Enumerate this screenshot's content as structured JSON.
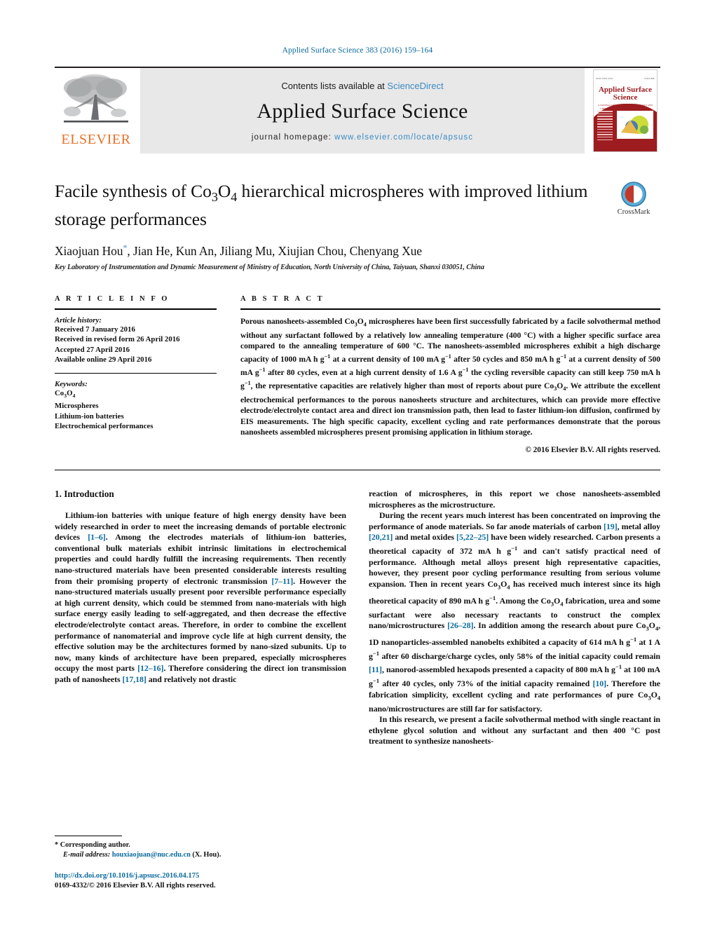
{
  "running_head": "Applied Surface Science 383 (2016) 159–164",
  "masthead": {
    "publisher_name": "ELSEVIER",
    "contents_prefix": "Contents lists available at ",
    "contents_link": "ScienceDirect",
    "journal_name": "Applied Surface Science",
    "homepage_prefix": "journal homepage: ",
    "homepage_url": "www.elsevier.com/locate/apsusc",
    "cover": {
      "title": "Applied Surface Science",
      "els_mark": "ELS",
      "header_left": "ISSN 0169-4332",
      "header_right": "VOLUME",
      "subtitle": "A JOURNAL DEVOTED TO APPLIED PHYSICS AND CHEMISTRY OF SURFACES AND INTERFACES"
    }
  },
  "article": {
    "title": "Facile synthesis of Co3O4 hierarchical microspheres with improved lithium storage performances",
    "title_part1": "Facile synthesis of Co",
    "title_sub1": "3",
    "title_part2": "O",
    "title_sub2": "4",
    "title_part3": " hierarchical microspheres with improved lithium storage performances",
    "authors": "Xiaojuan Hou, Jian He, Kun An, Jiliang Mu, Xiujian Chou, Chenyang Xue",
    "corresponding_marker": "*",
    "affiliation": "Key Laboratory of Instrumentation and Dynamic Measurement of Ministry of Education, North University of China, Taiyuan, Shanxi 030051, China",
    "crossmark_label": "CrossMark"
  },
  "article_info": {
    "heading": "A R T I C L E    I N F O",
    "history_label": "Article history:",
    "history": [
      "Received 7 January 2016",
      "Received in revised form 26 April 2016",
      "Accepted 27 April 2016",
      "Available online 29 April 2016"
    ],
    "keywords_label": "Keywords:",
    "keywords": [
      "Co3O4",
      "Microspheres",
      "Lithium-ion batteries",
      "Electrochemical performances"
    ]
  },
  "abstract": {
    "heading": "A B S T R A C T",
    "text": "Porous nanosheets-assembled Co3O4 microspheres have been first successfully fabricated by a facile solvothermal method without any surfactant followed by a relatively low annealing temperature (400 °C) with a higher specific surface area compared to the annealing temperature of 600 °C. The nanosheets-assembled microspheres exhibit a high discharge capacity of 1000 mA h g−1 at a current density of 100 mA g−1 after 50 cycles and 850 mA h g−1 at a current density of 500 mA g−1 after 80 cycles, even at a high current density of 1.6 A g−1 the cycling reversible capacity can still keep 750 mA h g−1, the representative capacities are relatively higher than most of reports about pure Co3O4. We attribute the excellent electrochemical performances to the porous nanosheets structure and architectures, which can provide more effective electrode/electrolyte contact area and direct ion transmission path, then lead to faster lithium-ion diffusion, confirmed by EIS measurements. The high specific capacity, excellent cycling and rate performances demonstrate that the porous nanosheets assembled microspheres present promising application in lithium storage.",
    "copyright": "© 2016 Elsevier B.V. All rights reserved."
  },
  "body": {
    "section_number_title": "1.  Introduction",
    "left_paragraph_1": "Lithium-ion batteries with unique feature of high energy density have been widely researched in order to meet the increasing demands of portable electronic devices [1–6]. Among the electrodes materials of lithium-ion batteries, conventional bulk materials exhibit intrinsic limitations in electrochemical properties and could hardly fulfill the increasing requirements. Then recently nano-structured materials have been presented considerable interests resulting from their promising property of electronic transmission [7–11]. However the nano-structured materials usually present poor reversible performance especially at high current density, which could be stemmed from nano-materials with high surface energy easily leading to self-aggregated, and then decrease the effective electrode/electrolyte contact areas. Therefore, in order to combine the excellent performance of nanomaterial and improve cycle life at high current density, the effective solution may be the architectures formed by nano-sized subunits. Up to now, many kinds of architecture have been prepared, especially microspheres occupy the most parts [12–16]. Therefore considering the direct ion transmission path of nanosheets [17,18] and relatively not drastic",
    "right_paragraph_1": "reaction of microspheres, in this report we chose nanosheets-assembled microspheres as the microstructure.",
    "right_paragraph_2": "During the recent years much interest has been concentrated on improving the performance of anode materials. So far anode materials of carbon [19], metal alloy [20,21] and metal oxides [5,22–25] have been widely researched. Carbon presents a theoretical capacity of 372 mA h g−1 and can't satisfy practical need of performance. Although metal alloys present high representative capacities, however, they present poor cycling performance resulting from serious volume expansion. Then in recent years Co3O4 has received much interest since its high theoretical capacity of 890 mA h g−1. Among the Co3O4 fabrication, urea and some surfactant were also necessary reactants to construct the complex nano/microstructures [26–28]. In addition among the research about pure Co3O4, 1D nanoparticles-assembled nanobelts exhibited a capacity of 614 mA h g−1 at 1 A g−1 after 60 discharge/charge cycles, only 58% of the initial capacity could remain [11], nanorod-assembled hexapods presented a capacity of 800 mA h g−1 at 100 mA g−1 after 40 cycles, only 73% of the initial capacity remained [10]. Therefore the fabrication simplicity, excellent cycling and rate performances of pure Co3O4 nano/microstructures are still far for satisfactory.",
    "right_paragraph_3": "In this research, we present a facile solvothermal method with single reactant in ethylene glycol solution and without any surfactant and then 400 °C post treatment to synthesize nanosheets-"
  },
  "footnotes": {
    "corresponding": "* Corresponding author.",
    "email_label": "E-mail address:",
    "email": "houxiaojuan@nuc.edu.cn",
    "email_suffix": "(X. Hou).",
    "doi": "http://dx.doi.org/10.1016/j.apsusc.2016.04.175",
    "issn_copyright": "0169-4332/© 2016 Elsevier B.V. All rights reserved."
  },
  "colors": {
    "link_blue": "#3b8ac4",
    "ref_blue": "#0b6a9e",
    "elsevier_orange": "#ea7125",
    "cover_red": "#9d1c20",
    "masthead_grey": "#e8e8e8"
  }
}
